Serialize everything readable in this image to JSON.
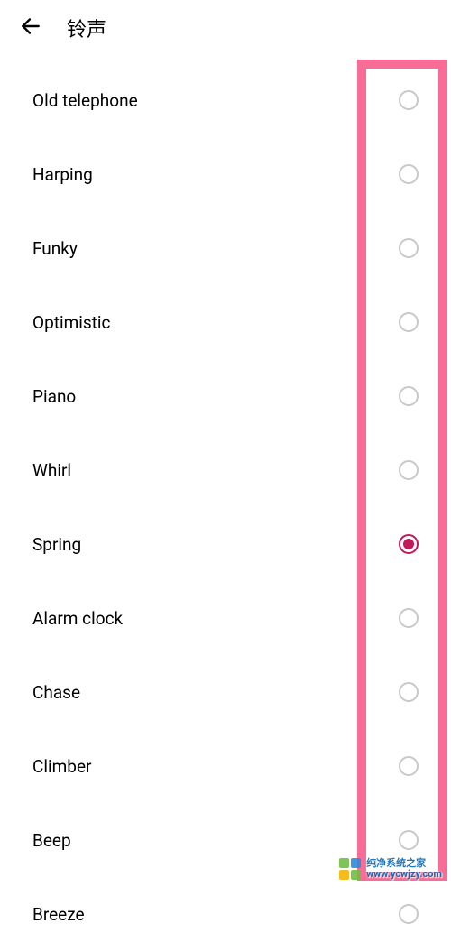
{
  "header": {
    "title": "铃声"
  },
  "ringtones": [
    {
      "label": "Old telephone",
      "selected": false
    },
    {
      "label": "Harping",
      "selected": false
    },
    {
      "label": "Funky",
      "selected": false
    },
    {
      "label": "Optimistic",
      "selected": false
    },
    {
      "label": "Piano",
      "selected": false
    },
    {
      "label": "Whirl",
      "selected": false
    },
    {
      "label": "Spring",
      "selected": true
    },
    {
      "label": "Alarm clock",
      "selected": false
    },
    {
      "label": "Chase",
      "selected": false
    },
    {
      "label": "Climber",
      "selected": false
    },
    {
      "label": "Beep",
      "selected": false
    },
    {
      "label": "Breeze",
      "selected": false
    }
  ],
  "colors": {
    "accent": "#c2185b",
    "highlight_border": "#f76d97"
  },
  "watermark": {
    "name": "纯净系统之家",
    "url": "www.ycwjzy.com",
    "logo_colors": [
      "#6fbf44",
      "#2e8bd8",
      "#f7b500",
      "#6fbf44"
    ]
  }
}
